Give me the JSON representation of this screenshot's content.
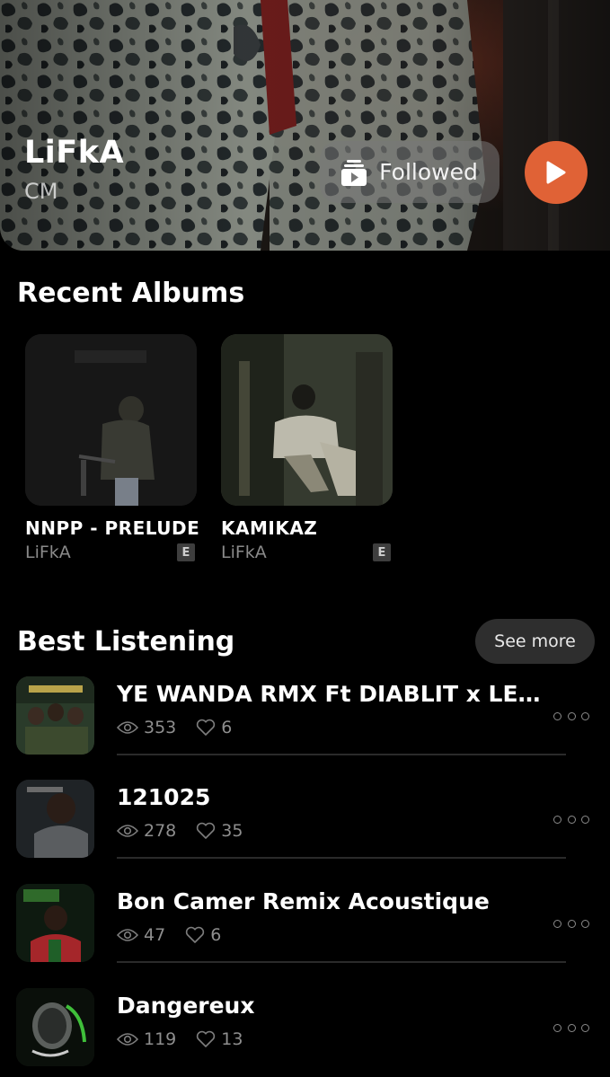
{
  "artist": {
    "name": "LiFkA",
    "country": "CM",
    "follow_label": "Followed",
    "accent_color": "#e06236"
  },
  "albums_section": {
    "title": "Recent Albums",
    "items": [
      {
        "title": "NNPP - PRELUDE",
        "artist": "LiFkA",
        "explicit": "E"
      },
      {
        "title": "KAMIKAZ",
        "artist": "LiFkA",
        "explicit": "E"
      }
    ]
  },
  "best_section": {
    "title": "Best Listening",
    "see_more": "See more",
    "tracks": [
      {
        "title": "YE WANDA RMX Ft DIABLIT x LE TA...",
        "views": "353",
        "likes": "6"
      },
      {
        "title": "121025",
        "views": "278",
        "likes": "35"
      },
      {
        "title": "Bon Camer Remix Acoustique",
        "views": "47",
        "likes": "6"
      },
      {
        "title": "Dangereux",
        "views": "119",
        "likes": "13"
      }
    ]
  },
  "icons": {
    "follow": "followed-library-icon",
    "play": "play-icon",
    "views": "eye-icon",
    "likes": "heart-icon",
    "more": "more-dots-icon"
  }
}
